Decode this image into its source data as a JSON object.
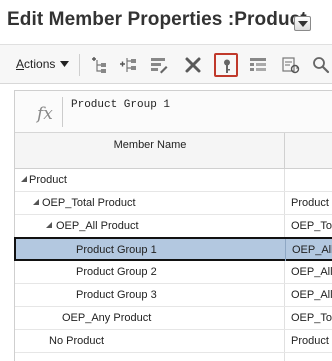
{
  "title": "Edit Member Properties :Product",
  "toolbar": {
    "actions_label": "Actions",
    "actions_underlined": "A",
    "actions_rest": "ctions",
    "icons": [
      "add-child-icon",
      "add-sibling-icon",
      "edit-properties-icon",
      "delete-icon",
      "key-icon",
      "columns-icon",
      "refresh-icon",
      "search-icon"
    ]
  },
  "formula_bar": {
    "fx": "fx",
    "value": "Product Group 1"
  },
  "grid": {
    "columns": [
      "Member Name",
      ""
    ],
    "rows": [
      {
        "name": "Product",
        "col2": "",
        "level": 0,
        "expanded": true
      },
      {
        "name": "OEP_Total Product",
        "col2": "Product",
        "level": 1,
        "expanded": true
      },
      {
        "name": "OEP_All Product",
        "col2": "OEP_Tot",
        "level": 2,
        "expanded": true
      },
      {
        "name": "Product Group 1",
        "col2": "OEP_All",
        "level": 3,
        "selected": true
      },
      {
        "name": "Product Group 2",
        "col2": "OEP_All",
        "level": 3
      },
      {
        "name": "Product Group 3",
        "col2": "OEP_All",
        "level": 3
      },
      {
        "name": "OEP_Any Product",
        "col2": "OEP_Tot",
        "level": 2
      },
      {
        "name": "No Product",
        "col2": "Product",
        "level": 1
      }
    ]
  },
  "colors": {
    "selected_row": "#b3c8e0",
    "selected_toolbar_border": "#c0392b",
    "delete_icon": "#5a5a5a"
  }
}
